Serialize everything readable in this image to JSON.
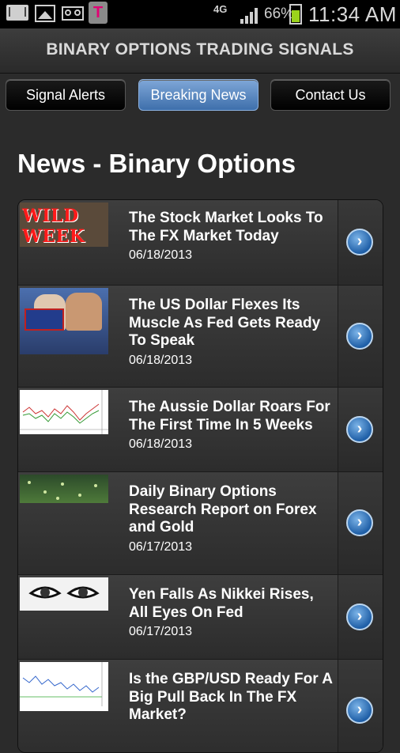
{
  "status_bar": {
    "network": "4G",
    "battery_percent": "66%",
    "time": "11:34 AM",
    "carrier_logo": "T",
    "battery_level": 0.66
  },
  "app": {
    "title": "BINARY OPTIONS TRADING SIGNALS"
  },
  "nav": [
    {
      "label": "Signal Alerts",
      "active": false
    },
    {
      "label": "Breaking News",
      "active": true
    },
    {
      "label": "Contact Us",
      "active": false
    }
  ],
  "page": {
    "heading": "News - Binary Options"
  },
  "thumb_texts": {
    "wild_week": "WILD WEEK"
  },
  "news": [
    {
      "title": "The Stock Market Looks To The FX Market Today",
      "date": "06/18/2013",
      "thumb": "wild-week-image"
    },
    {
      "title": "The US Dollar Flexes Its Muscle As Fed Gets Ready To Speak",
      "date": "06/18/2013",
      "thumb": "flag-photo"
    },
    {
      "title": "The Aussie Dollar Roars For The First Time In 5 Weeks",
      "date": "06/18/2013",
      "thumb": "forex-chart"
    },
    {
      "title": "Daily Binary Options Research Report on Forex and Gold",
      "date": "06/17/2013",
      "thumb": "green-board"
    },
    {
      "title": "Yen Falls As Nikkei Rises, All Eyes On Fed",
      "date": "06/17/2013",
      "thumb": "eyes-image"
    },
    {
      "title": "Is the GBP/USD Ready For A Big Pull Back In The FX Market?",
      "date": "",
      "thumb": "forex-chart-2"
    }
  ],
  "colors": {
    "active_tab": "#4f7fbf",
    "arrow": "#2f72b8",
    "background": "#2b2b2b"
  },
  "icons": {
    "row_arrow": "chevron-right-circle-icon"
  }
}
